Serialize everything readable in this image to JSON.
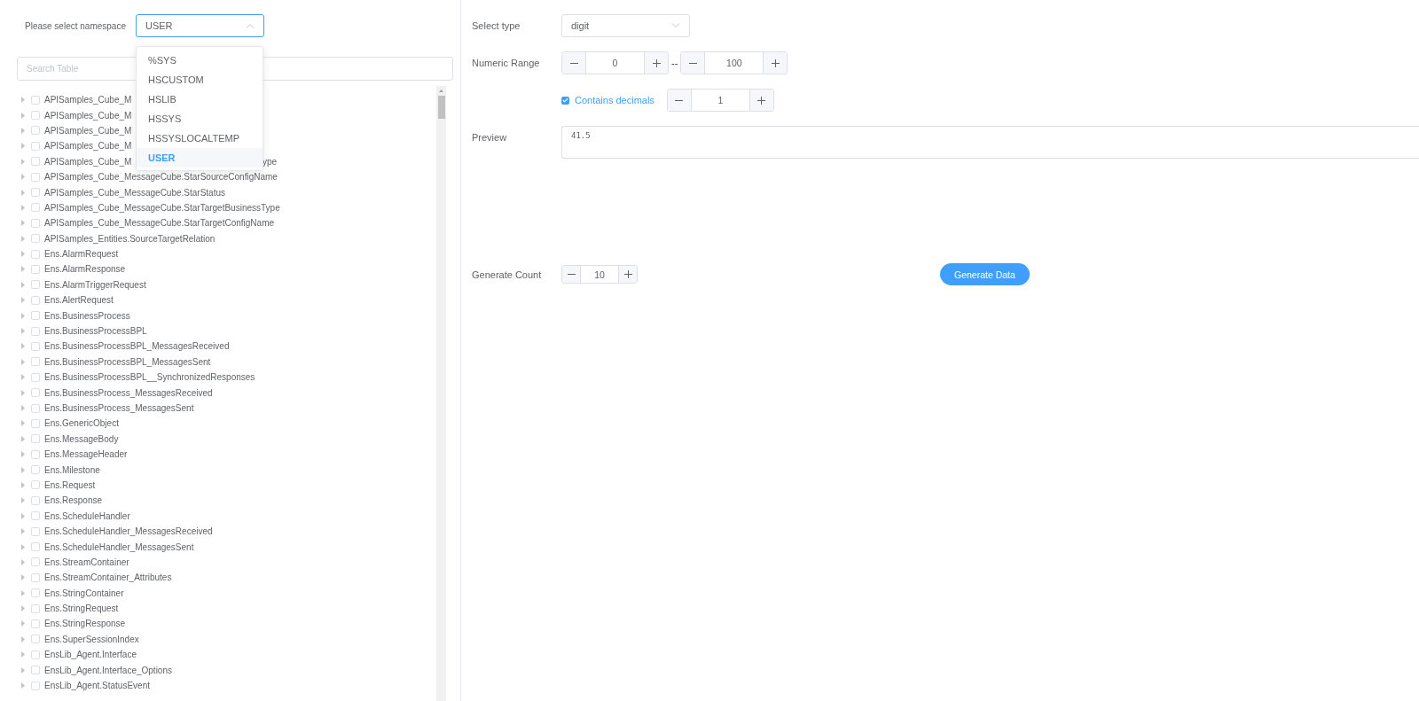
{
  "namespace": {
    "label": "Please select namespace",
    "value": "USER",
    "open": true,
    "options": [
      {
        "label": "%SYS",
        "selected": false
      },
      {
        "label": "HSCUSTOM",
        "selected": false
      },
      {
        "label": "HSLIB",
        "selected": false
      },
      {
        "label": "HSSYS",
        "selected": false
      },
      {
        "label": "HSSYSLOCALTEMP",
        "selected": false
      },
      {
        "label": "USER",
        "selected": true
      }
    ]
  },
  "search": {
    "placeholder": "Search Table"
  },
  "tree": [
    {
      "text": "APISamples_Cube_M",
      "checked": false
    },
    {
      "text": "APISamples_Cube_M",
      "checked": false
    },
    {
      "text": "APISamples_Cube_M",
      "checked": false
    },
    {
      "text": "APISamples_Cube_M",
      "checked": false
    },
    {
      "text": "APISamples_Cube_M",
      "tail": "ype",
      "checked": false
    },
    {
      "text": "APISamples_Cube_MessageCube.StarSourceConfigName",
      "checked": false
    },
    {
      "text": "APISamples_Cube_MessageCube.StarStatus",
      "checked": false
    },
    {
      "text": "APISamples_Cube_MessageCube.StarTargetBusinessType",
      "checked": false
    },
    {
      "text": "APISamples_Cube_MessageCube.StarTargetConfigName",
      "checked": false
    },
    {
      "text": "APISamples_Entities.SourceTargetRelation",
      "checked": false
    },
    {
      "text": "Ens.AlarmRequest",
      "checked": false
    },
    {
      "text": "Ens.AlarmResponse",
      "checked": false
    },
    {
      "text": "Ens.AlarmTriggerRequest",
      "checked": false
    },
    {
      "text": "Ens.AlertRequest",
      "checked": false
    },
    {
      "text": "Ens.BusinessProcess",
      "checked": false
    },
    {
      "text": "Ens.BusinessProcessBPL",
      "checked": false
    },
    {
      "text": "Ens.BusinessProcessBPL_MessagesReceived",
      "checked": false
    },
    {
      "text": "Ens.BusinessProcessBPL_MessagesSent",
      "checked": false
    },
    {
      "text": "Ens.BusinessProcessBPL__SynchronizedResponses",
      "checked": false
    },
    {
      "text": "Ens.BusinessProcess_MessagesReceived",
      "checked": false
    },
    {
      "text": "Ens.BusinessProcess_MessagesSent",
      "checked": false
    },
    {
      "text": "Ens.GenericObject",
      "checked": false
    },
    {
      "text": "Ens.MessageBody",
      "checked": false
    },
    {
      "text": "Ens.MessageHeader",
      "checked": false
    },
    {
      "text": "Ens.Milestone",
      "checked": false
    },
    {
      "text": "Ens.Request",
      "checked": false
    },
    {
      "text": "Ens.Response",
      "checked": false
    },
    {
      "text": "Ens.ScheduleHandler",
      "checked": false
    },
    {
      "text": "Ens.ScheduleHandler_MessagesReceived",
      "checked": false
    },
    {
      "text": "Ens.ScheduleHandler_MessagesSent",
      "checked": false
    },
    {
      "text": "Ens.StreamContainer",
      "checked": false
    },
    {
      "text": "Ens.StreamContainer_Attributes",
      "checked": false
    },
    {
      "text": "Ens.StringContainer",
      "checked": false
    },
    {
      "text": "Ens.StringRequest",
      "checked": false
    },
    {
      "text": "Ens.StringResponse",
      "checked": false
    },
    {
      "text": "Ens.SuperSessionIndex",
      "checked": false
    },
    {
      "text": "EnsLib_Agent.Interface",
      "checked": false
    },
    {
      "text": "EnsLib_Agent.Interface_Options",
      "checked": false
    },
    {
      "text": "EnsLib_Agent.StatusEvent",
      "checked": false
    }
  ],
  "form": {
    "type": {
      "label": "Select type",
      "value": "digit"
    },
    "range": {
      "label": "Numeric Range",
      "min": "0",
      "separator": "--",
      "max": "100"
    },
    "decimals": {
      "label": "Contains decimals",
      "checked": true,
      "value": "1"
    },
    "preview": {
      "label": "Preview",
      "value": "41.5"
    },
    "count": {
      "label": "Generate Count",
      "value": "10"
    },
    "button": "Generate Data"
  }
}
